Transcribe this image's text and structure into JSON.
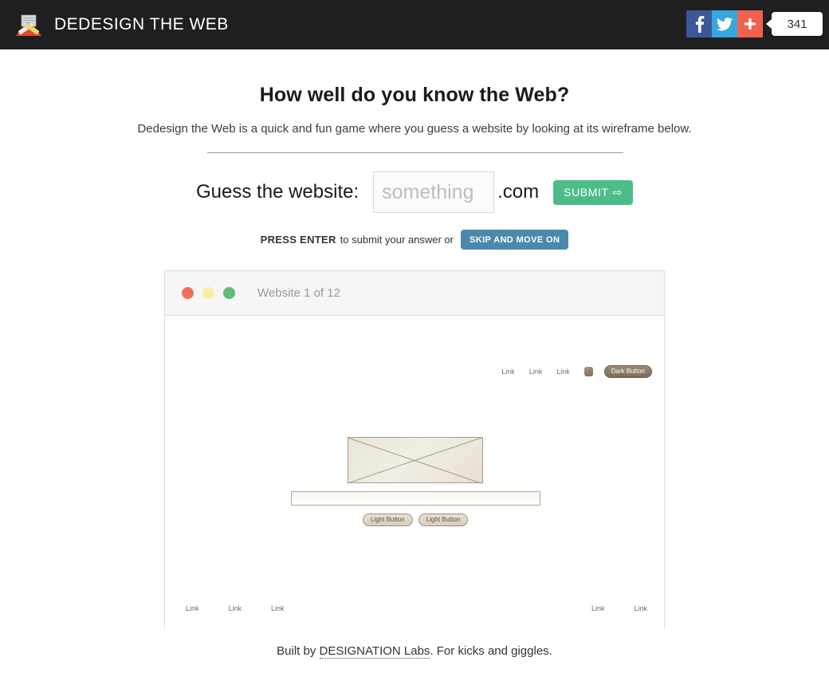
{
  "header": {
    "brand": "DEDESIGN THE WEB",
    "logo_icon": "envelope-pencil-logo-icon",
    "social": [
      {
        "icon": "facebook-icon",
        "label": "f",
        "color": "#3b5998",
        "name": "facebook-share-button"
      },
      {
        "icon": "twitter-icon",
        "label": "t",
        "color": "#37a8dd",
        "name": "twitter-share-button"
      },
      {
        "icon": "plus-icon",
        "label": "+",
        "color": "#f0624d",
        "name": "more-share-button"
      }
    ],
    "share_count": "341"
  },
  "main": {
    "title": "How well do you know the Web?",
    "subtitle": "Dedesign the Web is a quick and fun game where you guess a website by looking at its wireframe below.",
    "guess": {
      "label": "Guess the website:",
      "input_value": "",
      "input_placeholder": "something",
      "suffix": ".com",
      "submit_label": "SUBMIT",
      "submit_icon": "arrow-right-icon"
    },
    "hint": {
      "strong": "PRESS ENTER",
      "text": "to submit your answer or",
      "skip_label": "SKIP AND MOVE ON"
    }
  },
  "browser": {
    "dots": [
      "red",
      "yellow",
      "green"
    ],
    "caption": "Website 1 of 12",
    "wireframe": {
      "nav_links": [
        "Link",
        "Link",
        "Link"
      ],
      "nav_avatar_icon": "avatar-dot-icon",
      "dark_button_label": "Dark Button",
      "image_placeholder_icon": "image-placeholder-icon",
      "content_bar_icon": "content-bar-icon",
      "light_buttons": [
        "Light Button",
        "Light Button"
      ],
      "footer_links_left": [
        "Link",
        "Link",
        "Link"
      ],
      "footer_links_right": [
        "Link",
        "Link"
      ]
    }
  },
  "footer": {
    "prefix": "Built by ",
    "link": "DESIGNATION Labs",
    "suffix": ". For kicks and giggles."
  },
  "colors": {
    "header_bg": "#1f1f1f",
    "submit_green": "#4cbd89",
    "skip_blue": "#4a89ab",
    "facebook": "#3b5998",
    "twitter": "#37a8dd",
    "plus": "#f0624d"
  }
}
